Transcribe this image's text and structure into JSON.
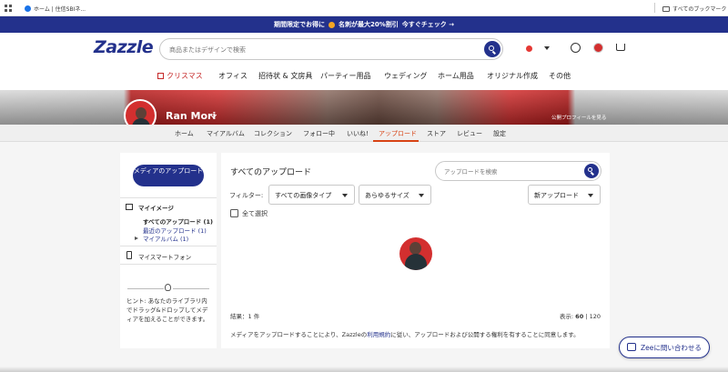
{
  "browser": {
    "bookmark_1": "ホーム | 住信SBIネ...",
    "all_bookmarks": "すべてのブックマーク"
  },
  "promo": {
    "before": "期間限定でお得に",
    "middle": "名刺が最大20%割引",
    "cta": "今すぐチェック →"
  },
  "header": {
    "logo": "Zazzle",
    "search_placeholder": "商品またはデザインで検索"
  },
  "nav": {
    "items": [
      "クリスマス",
      "オフィス",
      "招待状 & 文房具",
      "パーティー用品",
      "ウェディング",
      "ホーム用品",
      "オリジナル作成",
      "その他"
    ]
  },
  "profile": {
    "name": "Ran Mori",
    "public_link": "公開プロフィールを見る",
    "tabs": [
      "ホーム",
      "マイアルバム",
      "コレクション",
      "フォロー中",
      "いいね!",
      "アップロード",
      "ストア",
      "レビュー",
      "設定"
    ],
    "active_tab": "アップロード"
  },
  "sidebar": {
    "upload_button": "メディアのアップロード",
    "my_images": "マイイメージ",
    "all_uploads": "すべてのアップロード (1)",
    "recent_uploads": "最近のアップロード (1)",
    "my_albums": "マイアルバム (1)",
    "smartphone": "マイスマートフォン",
    "hint": "ヒント: あなたのライブラリ内でドラッグ&ドロップしてメディアを加えることができます。"
  },
  "main": {
    "title": "すべてのアップロード",
    "search_placeholder": "アップロードを検索",
    "filter_label": "フィルター:",
    "filter_type": "すべての画像タイプ",
    "filter_size": "あらゆるサイズ",
    "sort": "新アップロード",
    "select_all": "全て選択",
    "result_count": "結果：1 件",
    "show_label": "表示:",
    "show_60": "60",
    "show_sep": "|",
    "show_120": "120",
    "legal_before": "メディアをアップロードすることにより、Zazzleの",
    "legal_link": "利用規約",
    "legal_after": "に従い、アップロードおよび公開する権利を有することに同意します。"
  },
  "help": {
    "label": "Zeeに問い合わせる"
  },
  "colors": {
    "brand": "#23318c",
    "active_tab": "#d84315",
    "christmas": "#c62828"
  }
}
